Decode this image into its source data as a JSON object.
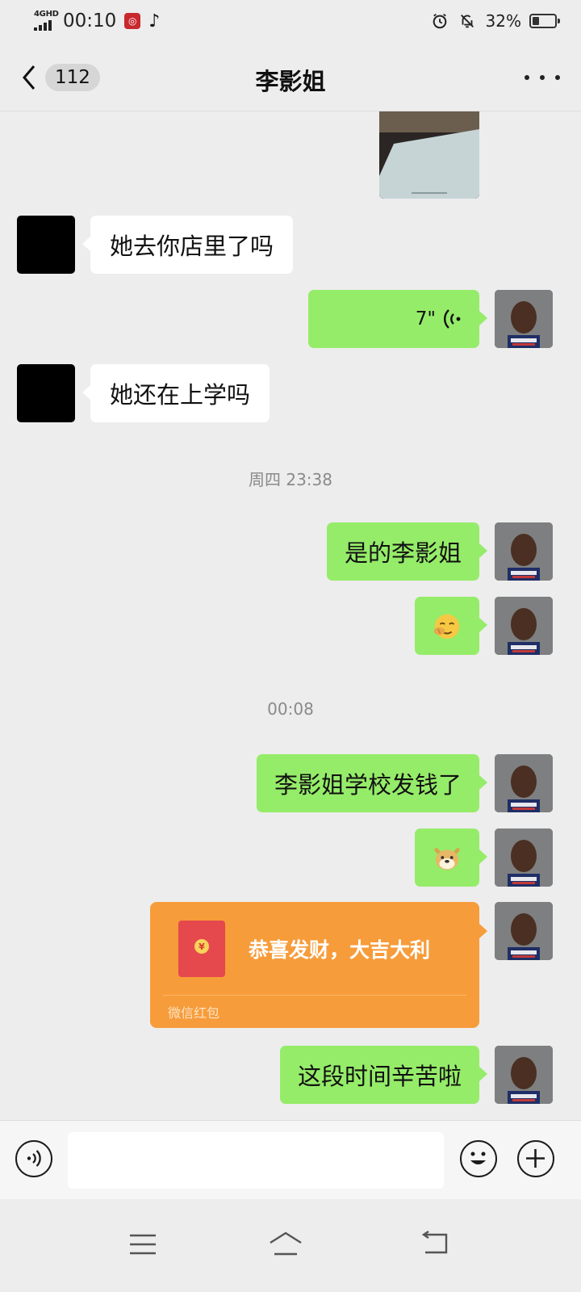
{
  "status_bar": {
    "network": "4GHD",
    "time": "00:10",
    "battery": "32%",
    "battery_level": 0.32,
    "icons": [
      "signal-icon",
      "app-notification-icon",
      "tiktok-icon",
      "alarm-icon",
      "mute-icon",
      "battery-icon"
    ]
  },
  "header": {
    "unread_count": "112",
    "title": "李影姐",
    "back_icon": "chevron-left-icon",
    "more_icon": "more-dots-icon"
  },
  "messages": [
    {
      "sender": "me",
      "type": "image"
    },
    {
      "sender": "other",
      "type": "text",
      "text": "她去你店里了吗"
    },
    {
      "sender": "me",
      "type": "voice",
      "duration": "7\""
    },
    {
      "sender": "other",
      "type": "text",
      "text": "她还在上学吗"
    },
    {
      "type": "timestamp",
      "text": "周四 23:38"
    },
    {
      "sender": "me",
      "type": "text",
      "text": "是的李影姐"
    },
    {
      "sender": "me",
      "type": "emoji",
      "emoji": "facepalm-emoji"
    },
    {
      "type": "timestamp",
      "text": "00:08"
    },
    {
      "sender": "me",
      "type": "text",
      "text": "李影姐学校发钱了"
    },
    {
      "sender": "me",
      "type": "emoji",
      "emoji": "doge-emoji"
    },
    {
      "sender": "me",
      "type": "red_packet",
      "text": "恭喜发财，大吉大利",
      "label": "微信红包"
    },
    {
      "sender": "me",
      "type": "text",
      "text": "这段时间辛苦啦"
    }
  ],
  "input_bar": {
    "voice_icon": "voice-input-icon",
    "value": "",
    "emoji_icon": "smiley-icon",
    "add_icon": "plus-icon"
  },
  "system_nav": {
    "icons": [
      "menu-icon",
      "home-icon",
      "back-icon"
    ]
  },
  "colors": {
    "background": "#ededed",
    "my_bubble": "#95ec69",
    "other_bubble": "#ffffff",
    "red_packet": "#f79c3a"
  }
}
